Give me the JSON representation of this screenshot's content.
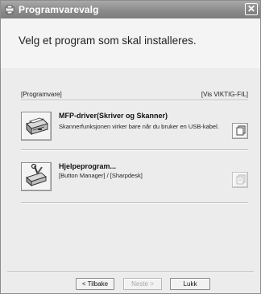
{
  "window": {
    "title": "Programvarevalg",
    "close_glyph": "✕"
  },
  "header": {
    "heading": "Velg et program som skal installeres."
  },
  "section": {
    "left_label": "[Programvare]",
    "right_label": "[Vis VIKTIG-FIL]"
  },
  "items": [
    {
      "title": "MFP-driver(Skriver og Skanner)",
      "description": "Skannerfunksjonen virker bare når du bruker en USB-kabel.",
      "icon": "printer-scanner-icon",
      "doc_enabled": true
    },
    {
      "title": "Hjelpeprogram...",
      "description": "[Button Manager] / [Sharpdesk]",
      "icon": "utility-tools-icon",
      "doc_enabled": false
    }
  ],
  "footer": {
    "back_label": "< Tilbake",
    "next_label": "Neste >",
    "close_label": "Lukk"
  }
}
